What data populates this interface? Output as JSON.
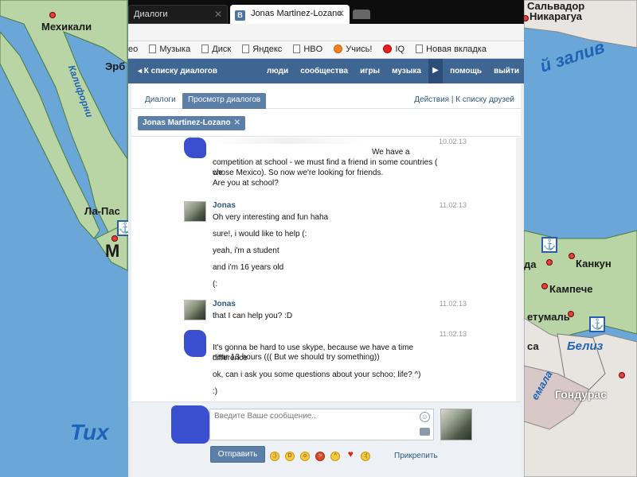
{
  "map": {
    "labels": {
      "mexicali": "Мехикали",
      "erb": "Эрб",
      "la_pas": "Ла-Пас",
      "m": "М",
      "california": "Калифорни",
      "tikh": "Тих",
      "salvador": "Сальвадор",
      "nicaragua": "Никарагуа",
      "gulf": "й залив",
      "cancun": "Канкун",
      "campeche": "Кампече",
      "chetumal": "етумаль",
      "belize": "Белиз",
      "honduras": "Гондурас",
      "guatemala": "емала",
      "da": "да",
      "sa": "са"
    },
    "colors": {
      "sea": "#6aa6d8",
      "land": "#b9d5a6",
      "land2": "#e8e4df"
    }
  },
  "browser": {
    "tabs": [
      {
        "label": "Диалоги",
        "close": "✕"
      },
      {
        "label": "Jonas Martinez-Lozano",
        "favicon": "B",
        "close": "✕"
      }
    ],
    "bookmarks": [
      {
        "label": "ео",
        "icon": "none"
      },
      {
        "label": "Музыка",
        "icon": "page"
      },
      {
        "label": "Диск",
        "icon": "page"
      },
      {
        "label": "Яндекс",
        "icon": "page"
      },
      {
        "label": "HBO",
        "icon": "page"
      },
      {
        "label": "Учись!",
        "icon": "orange"
      },
      {
        "label": "IQ",
        "icon": "red"
      },
      {
        "label": "Новая вкладка",
        "icon": "page"
      }
    ]
  },
  "vk": {
    "back_label": "◂ К списку диалогов",
    "nav": [
      "люди",
      "сообщества",
      "игры",
      "музыка",
      "помощь",
      "выйти"
    ],
    "nav_arrow": "▶",
    "subtabs": {
      "dialogs": "Диалоги",
      "view": "Просмотр диалогов"
    },
    "subright": "Действия | К списку друзей",
    "peer": {
      "name": "Jonas Martinez-Lozano",
      "close": "✕"
    },
    "messages": [
      {
        "author": "",
        "avatar": "blob",
        "date": "10.02.13",
        "lines": [
          "We have a",
          "competition at school - we must find a friend in some countries ( we",
          "chose Mexico). So now we're looking for friends.",
          "Are you at school?"
        ]
      },
      {
        "author": "Jonas",
        "avatar": "photo",
        "date": "11.02.13",
        "lines": [
          "Oh very interesting and fun haha",
          "sure!, i would like to help (:",
          "yeah, i'm a student",
          "and i'm 16 years old",
          "(:"
        ]
      },
      {
        "author": "Jonas",
        "avatar": "photo",
        "date": "11.02.13",
        "lines": [
          "that I can help you? :D"
        ]
      },
      {
        "author": "",
        "avatar": "blob",
        "date": "11.02.13",
        "lines": [
          "It's gonna be hard to use skype, because we have a time difference",
          "near 13 hours ((( But we should try something))",
          "ok, can i ask you some questions about your schoo; life? ^)",
          ":)"
        ]
      }
    ],
    "composer": {
      "placeholder": "Введите Ваше сообщение..",
      "send_label": "Отправить",
      "attach_label": "Прикрепить",
      "smile_glyph": "☺",
      "emojis": [
        "wink",
        "grin",
        "lol",
        "angry",
        "laugh",
        "heart",
        "worried"
      ]
    }
  }
}
